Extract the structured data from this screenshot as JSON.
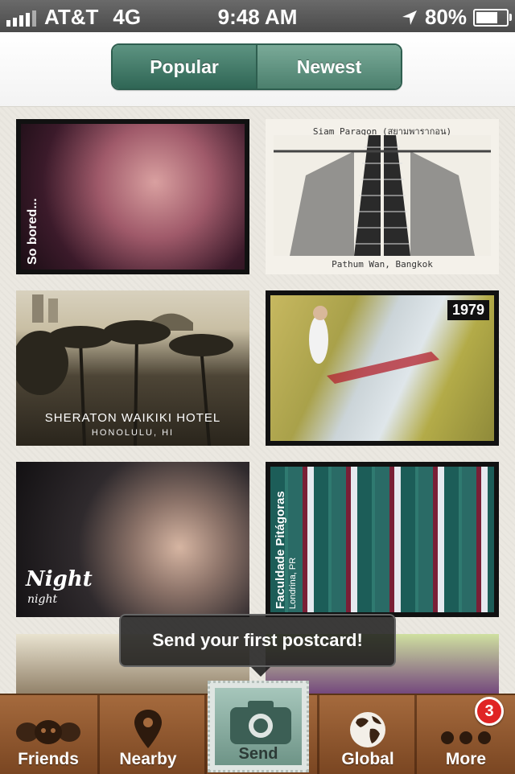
{
  "status_bar": {
    "carrier": "AT&T",
    "network": "4G",
    "time": "9:48 AM",
    "battery_percent": "80%",
    "battery_level": 0.8
  },
  "header": {
    "segments": [
      {
        "label": "Popular",
        "selected": true
      },
      {
        "label": "Newest",
        "selected": false
      }
    ]
  },
  "postcards": [
    {
      "caption": "So bored..."
    },
    {
      "caption_top": "Siam Paragon (สยามพารากอน)",
      "caption_bottom": "Pathum Wan, Bangkok"
    },
    {
      "title": "SHERATON WAIKIKI HOTEL",
      "subtitle": "HONOLULU, HI"
    },
    {
      "badge": "1979"
    },
    {
      "title": "Night",
      "subtitle": "night"
    },
    {
      "caption": "Faculdade Pitágoras",
      "sub_caption": "Londrina, PR"
    },
    {},
    {}
  ],
  "tooltip": {
    "text": "Send your first postcard!"
  },
  "tabbar": {
    "tabs": [
      {
        "label": "Friends",
        "icon": "friends-icon"
      },
      {
        "label": "Nearby",
        "icon": "location-pin-icon"
      },
      {
        "label": "Send",
        "icon": "camera-icon"
      },
      {
        "label": "Global",
        "icon": "globe-icon"
      },
      {
        "label": "More",
        "icon": "more-dots-icon"
      }
    ],
    "more_badge": "3"
  },
  "colors": {
    "segment_green": "#2f6655",
    "tabbar_wood": "#7a4622",
    "badge_red": "#e02424"
  }
}
